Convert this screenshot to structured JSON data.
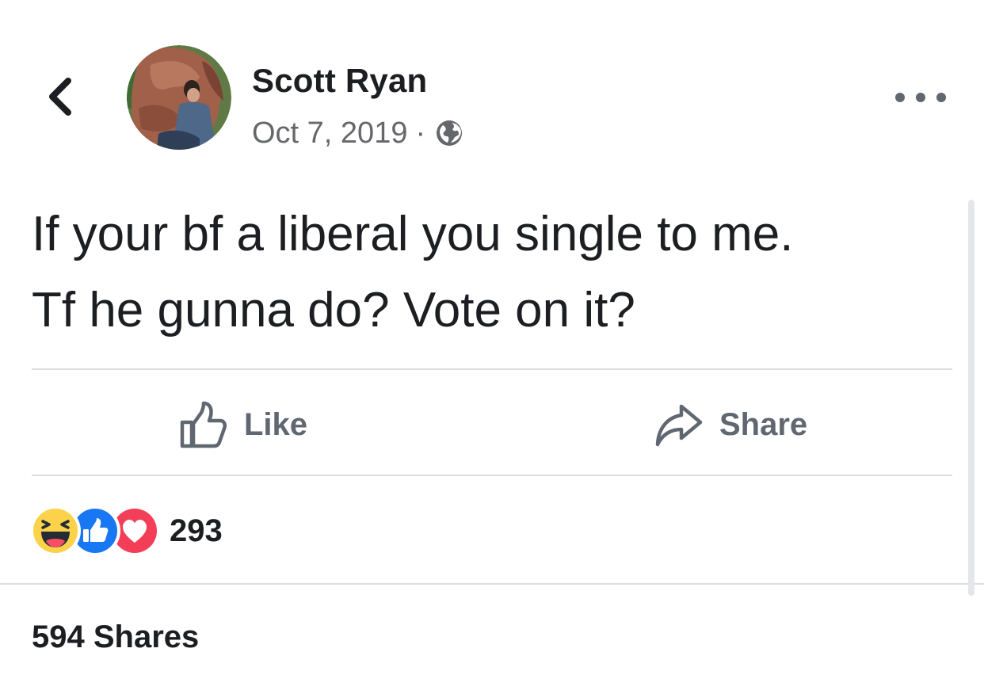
{
  "post": {
    "author_name": "Scott Ryan",
    "date": "Oct 7, 2019",
    "separator": "·",
    "privacy_icon": "globe-icon",
    "text_lines": [
      "If your bf a liberal you single to me.",
      "Tf he gunna do? Vote on it?"
    ]
  },
  "nav": {
    "back_icon": "chevron-left-icon",
    "more_icon": "more-horizontal-icon"
  },
  "actions": {
    "like_label": "Like",
    "share_label": "Share"
  },
  "reactions": {
    "icons": [
      "haha-icon",
      "like-icon",
      "love-icon"
    ],
    "count": "293"
  },
  "shares": {
    "label": "594 Shares"
  },
  "colors": {
    "text_primary": "#1c1e21",
    "text_secondary": "#65676b",
    "action_gray": "#606770",
    "divider": "#dadde1",
    "like_blue": "#1877f2",
    "love_red": "#f33e58",
    "haha_yellow": "#fcd24a"
  }
}
